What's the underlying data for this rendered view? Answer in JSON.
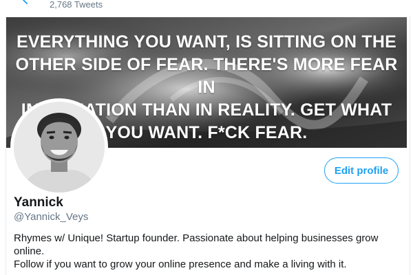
{
  "header": {
    "tweet_count": "2,768 Tweets"
  },
  "banner": {
    "quote_lines": [
      "EVERYTHING YOU WANT, IS SITTING ON THE",
      "OTHER SIDE OF FEAR. THERE'S MORE FEAR IN",
      "IMAGINATION THAN IN REALITY. GET WHAT",
      "YOU WANT. F*CK FEAR."
    ]
  },
  "profile": {
    "name": "Yannick",
    "handle": "@Yannick_Veys",
    "edit_label": "Edit profile",
    "bio_line1": "Rhymes w/ Unique! Startup founder. Passionate about helping businesses grow online.",
    "bio_line2": "Follow if you want to grow your online presence and make a living with it."
  },
  "colors": {
    "accent": "#1da1f2",
    "secondary_text": "#657786"
  }
}
